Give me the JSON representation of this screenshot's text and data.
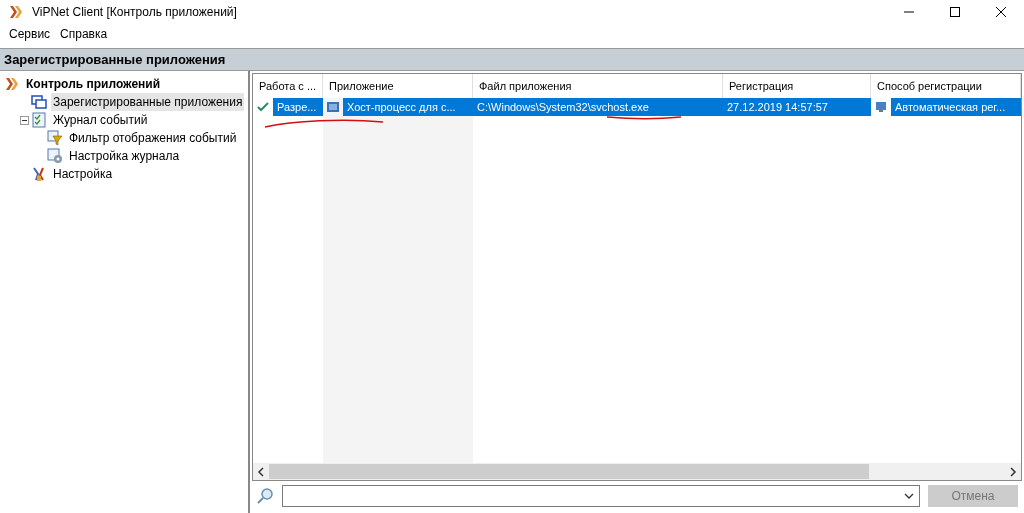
{
  "window": {
    "title": "ViPNet Client [Контроль приложений]"
  },
  "menu": [
    "Сервис",
    "Справка"
  ],
  "section_title": "Зарегистрированные приложения",
  "tree": [
    {
      "label": "Контроль приложений",
      "kind": "root",
      "selected": false,
      "children": [
        {
          "label": "Зарегистрированные приложения",
          "kind": "windows",
          "selected": true
        },
        {
          "label": "Журнал событий",
          "kind": "journal",
          "selected": false,
          "expanded": true,
          "children": [
            {
              "label": "Фильтр отображения событий",
              "kind": "filter",
              "selected": false
            },
            {
              "label": "Настройка журнала",
              "kind": "settings",
              "selected": false
            }
          ]
        },
        {
          "label": "Настройка",
          "kind": "tools",
          "selected": false
        }
      ]
    }
  ],
  "table": {
    "columns": [
      "Работа с ...",
      "Приложение",
      "Файл приложения",
      "Регистрация",
      "Способ регистрации"
    ],
    "rows": [
      {
        "selected": true,
        "cells": [
          "Разре...",
          "Хост-процесс для с...",
          "C:\\Windows\\System32\\svchost.exe",
          "27.12.2019 14:57:57",
          "Автоматическая рег..."
        ]
      }
    ]
  },
  "cancel_button": {
    "label": "Отмена",
    "disabled": true
  }
}
